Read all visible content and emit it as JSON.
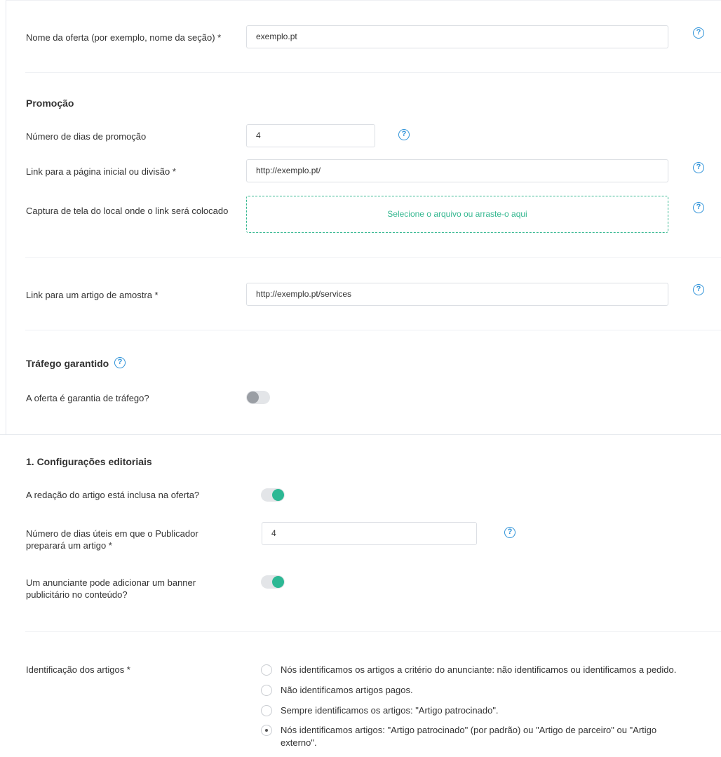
{
  "offer": {
    "name_label": "Nome da oferta (por exemplo, nome da seção) *",
    "name_value": "exemplo.pt"
  },
  "promotion": {
    "title": "Promoção",
    "days_label": "Número de dias de promoção",
    "days_value": "4",
    "link_label": "Link para a página inicial ou divisão *",
    "link_value": "http://exemplo.pt/",
    "screenshot_label": "Captura de tela do local onde o link será colocado",
    "dropzone_text": "Selecione o arquivo ou arraste-o aqui"
  },
  "sample": {
    "label": "Link para um artigo de amostra *",
    "value": "http://exemplo.pt/services"
  },
  "traffic": {
    "title": "Tráfego garantido",
    "question_label": "A oferta é garantia de tráfego?",
    "toggle_on": false
  },
  "editorial": {
    "title": "1. Configurações editoriais",
    "writing_label": "A redação do artigo está inclusa na oferta?",
    "writing_on": true,
    "days_label_line1": "Número de dias úteis em que o Publicador",
    "days_label_line2": "preparará um artigo *",
    "days_value": "4",
    "banner_label_line1": "Um anunciante pode adicionar um banner",
    "banner_label_line2": "publicitário no conteúdo?",
    "banner_on": true
  },
  "identification": {
    "label": "Identificação dos artigos *",
    "options": [
      {
        "text": "Nós identificamos os artigos a critério do anunciante: não identificamos ou identificamos a pedido.",
        "checked": false
      },
      {
        "text": "Não identificamos artigos pagos.",
        "checked": false
      },
      {
        "text": "Sempre identificamos os artigos: \"Artigo patrocinado\".",
        "checked": false
      },
      {
        "text_line1": "Nós identificamos artigos: \"Artigo patrocinado\" (por padrão) ou \"Artigo de parceiro\" ou \"Artigo",
        "text_line2": "externo\".",
        "checked": true
      }
    ]
  },
  "help_icon": "?",
  "colors": {
    "accent_green": "#2db894",
    "help_blue": "#2f93d9",
    "toggle_off": "#9a9ea4"
  }
}
